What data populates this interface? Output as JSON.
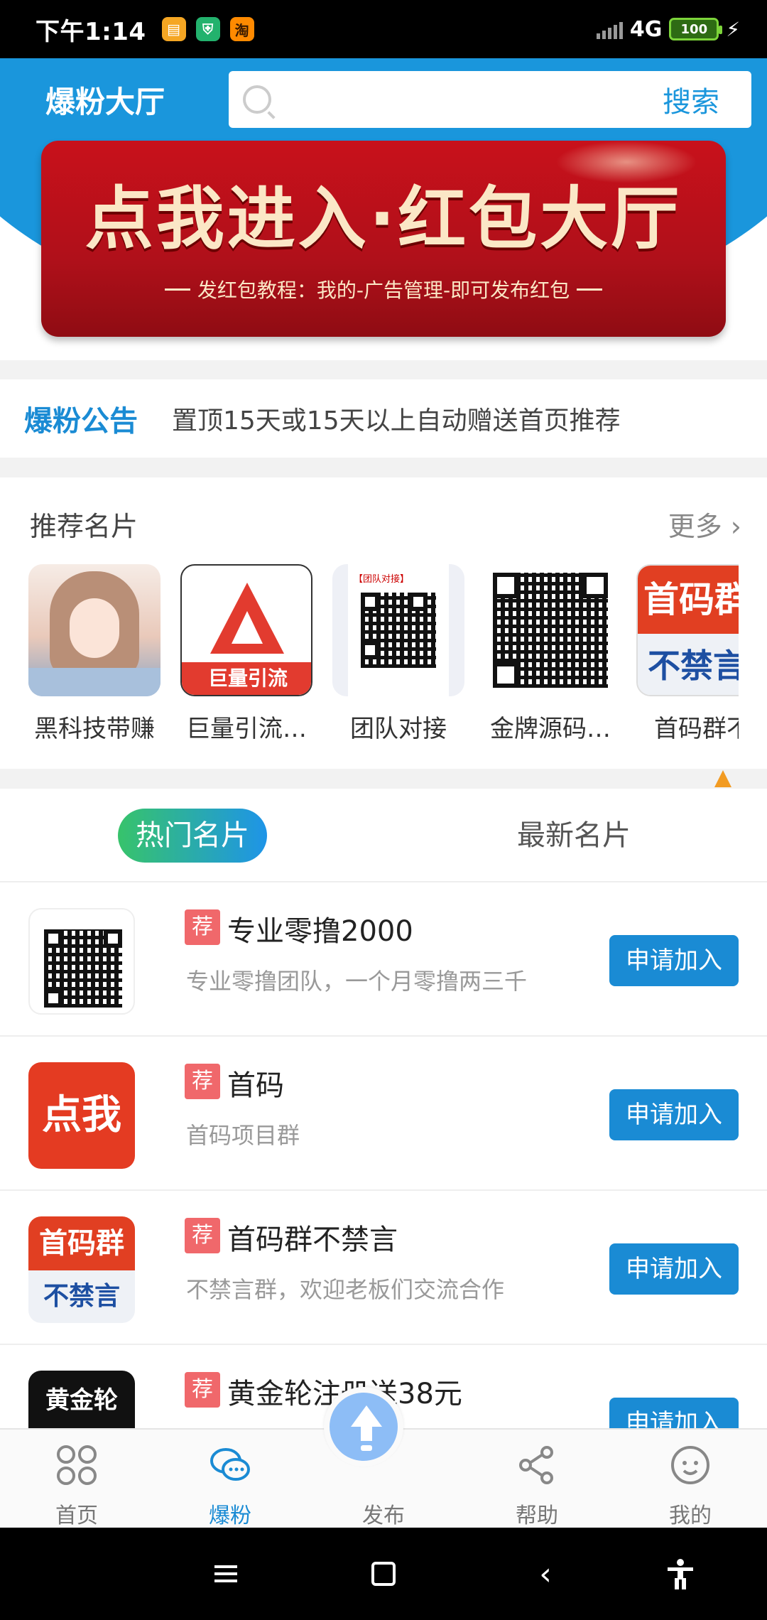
{
  "status_bar": {
    "time": "下午1:14",
    "apps": [
      "notes-app-icon",
      "shield-app-icon",
      "taobao-app-icon"
    ],
    "taobao_glyph": "淘",
    "network": "4G",
    "battery": "100"
  },
  "header": {
    "title": "爆粉大厅",
    "search_placeholder": "",
    "search_button": "搜索"
  },
  "banner": {
    "title": "点我进入·红包大厅",
    "subtitle": "发红包教程：我的-广告管理-即可发布红包"
  },
  "notice": {
    "label": "爆粉公告",
    "text": "置顶15天或15天以上自动赠送首页推荐"
  },
  "recommended": {
    "title": "推荐名片",
    "more": "更多",
    "cards": [
      {
        "name": "黑科技带赚"
      },
      {
        "name": "巨量引流…",
        "img_text": "巨量引流"
      },
      {
        "name": "团队对接",
        "img_text": "【团队对接】"
      },
      {
        "name": "金牌源码…"
      },
      {
        "name": "首码群不",
        "img_top": "首码群",
        "img_bottom": "不禁言"
      }
    ]
  },
  "tabs": {
    "hot": "热门名片",
    "new": "最新名片"
  },
  "list": {
    "badge": "荐",
    "apply_label": "申请加入",
    "items": [
      {
        "title": "专业零撸2000",
        "desc": "专业零撸团队，一个月零撸两三千"
      },
      {
        "title": "首码",
        "desc": "首码项目群",
        "thumb_text": "点我"
      },
      {
        "title": "首码群不禁言",
        "desc": "不禁言群，欢迎老板们交流合作",
        "thumb_top": "首码群",
        "thumb_bottom": "不禁言"
      },
      {
        "title": "黄金轮注册送38元",
        "desc": "",
        "thumb_text": "黄金轮"
      }
    ]
  },
  "bottom_nav": {
    "items": [
      "首页",
      "爆粉",
      "发布",
      "帮助",
      "我的"
    ],
    "active": "爆粉",
    "accent": "#1a8bd4"
  }
}
